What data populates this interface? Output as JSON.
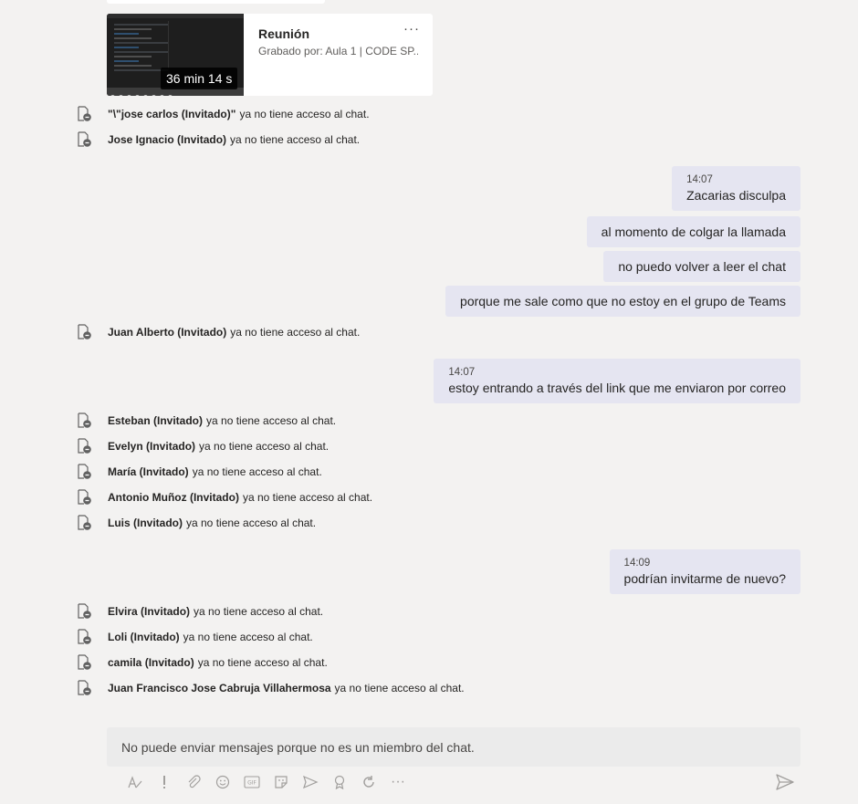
{
  "recording": {
    "title": "Reunión",
    "subtitle": "Grabado por: Aula 1 | CODE SP...",
    "duration": "36 min 14 s",
    "more": "···"
  },
  "messages": {
    "sys1": {
      "name": "\"\\\"jose carlos (Invitado)\"",
      "text": "ya no tiene acceso al chat."
    },
    "sys2": {
      "name": "Jose Ignacio (Invitado)",
      "text": "ya no tiene acceso al chat."
    },
    "b1": {
      "time": "14:07",
      "text": "Zacarias disculpa"
    },
    "b2": {
      "text": "al momento de colgar la llamada"
    },
    "b3": {
      "text": "no puedo volver a leer el chat"
    },
    "b4": {
      "text": "porque me sale como que no estoy en el grupo de Teams"
    },
    "sys3": {
      "name": "Juan Alberto (Invitado)",
      "text": "ya no tiene acceso al chat."
    },
    "b5": {
      "time": "14:07",
      "text": "estoy entrando a través del link que me enviaron por correo"
    },
    "sys4": {
      "name": "Esteban (Invitado)",
      "text": "ya no tiene acceso al chat."
    },
    "sys5": {
      "name": "Evelyn (Invitado)",
      "text": "ya no tiene acceso al chat."
    },
    "sys6": {
      "name": "María (Invitado)",
      "text": "ya no tiene acceso al chat."
    },
    "sys7": {
      "name": "Antonio Muñoz (Invitado)",
      "text": "ya no tiene acceso al chat."
    },
    "sys8": {
      "name": "Luis (Invitado)",
      "text": "ya no tiene acceso al chat."
    },
    "b6": {
      "time": "14:09",
      "text": "podrían invitarme de nuevo?"
    },
    "sys9": {
      "name": "Elvira (Invitado)",
      "text": "ya no tiene acceso al chat."
    },
    "sys10": {
      "name": "Loli (Invitado)",
      "text": "ya no tiene acceso al chat."
    },
    "sys11": {
      "name": "camila (Invitado)",
      "text": "ya no tiene acceso al chat."
    },
    "sys12": {
      "name": "Juan Francisco Jose Cabruja Villahermosa",
      "text": "ya no tiene acceso al chat."
    }
  },
  "composer": {
    "notice": "No puede enviar mensajes porque no es un miembro del chat.",
    "tools": [
      "format-icon",
      "important-icon",
      "attach-icon",
      "emoji-icon",
      "gif-icon",
      "sticker-icon",
      "meet-icon",
      "praise-icon",
      "loop-icon",
      "more-icon"
    ],
    "gif_label": "GIF",
    "more_label": "···"
  },
  "colors": {
    "background": "#f3f2f1",
    "bubble": "#e5e5f1",
    "card": "#ffffff",
    "icon": "#a19f9d"
  }
}
